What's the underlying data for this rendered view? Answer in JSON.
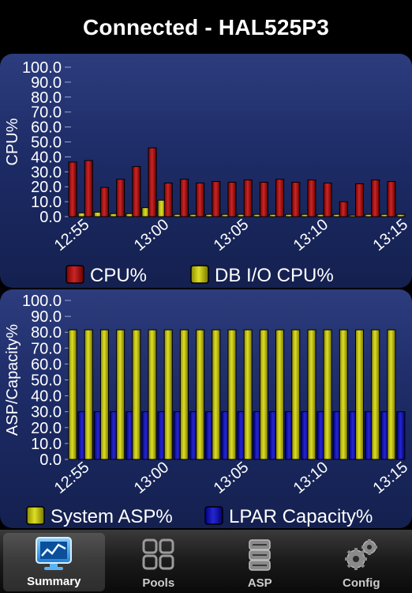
{
  "header": {
    "title": "Connected - HAL525P3"
  },
  "chart_data": [
    {
      "type": "bar",
      "ylabel": "CPU%",
      "ylim": [
        0,
        100
      ],
      "yticks": [
        "0.0",
        "10.0",
        "20.0",
        "30.0",
        "40.0",
        "50.0",
        "60.0",
        "70.0",
        "80.0",
        "90.0",
        "100.0"
      ],
      "xtick_labels": [
        "12:55",
        "13:00",
        "13:05",
        "13:10",
        "13:15"
      ],
      "categories": [
        "12:55",
        "12:56",
        "12:57",
        "12:58",
        "12:59",
        "13:00",
        "13:01",
        "13:02",
        "13:03",
        "13:04",
        "13:05",
        "13:06",
        "13:07",
        "13:08",
        "13:09",
        "13:10",
        "13:11",
        "13:12",
        "13:13",
        "13:14",
        "13:15"
      ],
      "series": [
        {
          "name": "CPU%",
          "color": "#c00000",
          "values": [
            36.5,
            37.5,
            19.5,
            25,
            33.5,
            46,
            22.5,
            25,
            22.5,
            23.5,
            23,
            24.5,
            23,
            25,
            23,
            24.5,
            22.5,
            10,
            22,
            24.5,
            23.5
          ]
        },
        {
          "name": "DB I/O CPU%",
          "color": "#d8d800",
          "values": [
            2.5,
            3,
            2,
            2,
            6,
            11,
            1.5,
            1.5,
            1.5,
            1.5,
            1.5,
            1.5,
            1.5,
            1.5,
            1.5,
            1.5,
            1.5,
            1,
            1.5,
            1.5,
            1.5
          ]
        }
      ]
    },
    {
      "type": "bar",
      "ylabel": "ASP/Capacity%",
      "ylim": [
        0,
        100
      ],
      "yticks": [
        "0.0",
        "10.0",
        "20.0",
        "30.0",
        "40.0",
        "50.0",
        "60.0",
        "70.0",
        "80.0",
        "90.0",
        "100.0"
      ],
      "xtick_labels": [
        "12:55",
        "13:00",
        "13:05",
        "13:10",
        "13:15"
      ],
      "categories": [
        "12:55",
        "12:56",
        "12:57",
        "12:58",
        "12:59",
        "13:00",
        "13:01",
        "13:02",
        "13:03",
        "13:04",
        "13:05",
        "13:06",
        "13:07",
        "13:08",
        "13:09",
        "13:10",
        "13:11",
        "13:12",
        "13:13",
        "13:14",
        "13:15"
      ],
      "series": [
        {
          "name": "System ASP%",
          "color": "#d8d800",
          "values": [
            81.5,
            81.5,
            81.5,
            81.5,
            81.5,
            81.5,
            81.5,
            81.5,
            81.5,
            81.5,
            81.5,
            81.5,
            81.5,
            81.5,
            81.5,
            81.5,
            81.5,
            81.5,
            81.5,
            81.5,
            81.5
          ]
        },
        {
          "name": "LPAR Capacity%",
          "color": "#0000c8",
          "values": [
            30,
            30,
            30,
            30,
            30,
            30,
            30,
            30,
            30,
            30,
            30,
            30,
            30,
            30,
            30,
            30,
            30,
            30,
            30,
            30,
            30
          ]
        }
      ]
    }
  ],
  "tabs": [
    {
      "label": "Summary",
      "icon": "monitor-chart-icon",
      "active": true
    },
    {
      "label": "Pools",
      "icon": "pools-grid-icon",
      "active": false
    },
    {
      "label": "ASP",
      "icon": "disk-stack-icon",
      "active": false
    },
    {
      "label": "Config",
      "icon": "gears-icon",
      "active": false
    }
  ]
}
